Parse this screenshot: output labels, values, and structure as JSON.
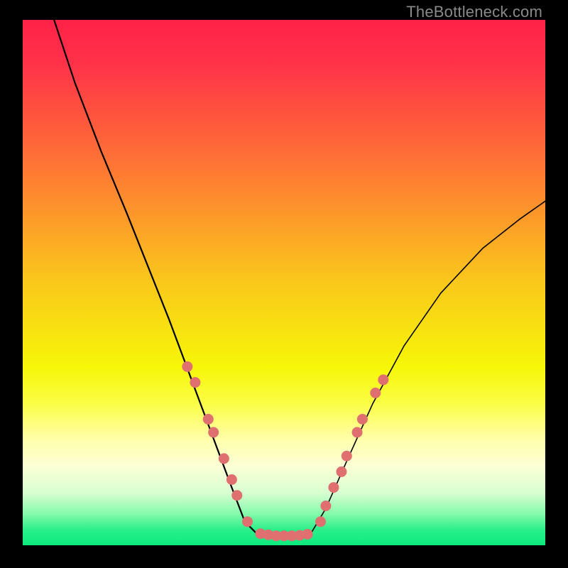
{
  "watermark": "TheBottleneck.com",
  "chart_data": {
    "type": "line",
    "title": "",
    "xlabel": "",
    "ylabel": "",
    "xlim": [
      0,
      100
    ],
    "ylim": [
      0,
      100
    ],
    "grid": false,
    "background_gradient_stops": [
      {
        "offset": 0.0,
        "color": "#FF2247"
      },
      {
        "offset": 0.08,
        "color": "#FF3149"
      },
      {
        "offset": 0.28,
        "color": "#FE7634"
      },
      {
        "offset": 0.5,
        "color": "#FAC81B"
      },
      {
        "offset": 0.66,
        "color": "#F6F607"
      },
      {
        "offset": 0.73,
        "color": "#FBFD45"
      },
      {
        "offset": 0.8,
        "color": "#FFFFAD"
      },
      {
        "offset": 0.85,
        "color": "#FBFFD5"
      },
      {
        "offset": 0.9,
        "color": "#D8FFD1"
      },
      {
        "offset": 0.94,
        "color": "#85FAAB"
      },
      {
        "offset": 0.97,
        "color": "#2BEF89"
      },
      {
        "offset": 1.0,
        "color": "#0CEA7D"
      }
    ],
    "series": [
      {
        "name": "left-branch",
        "color": "#000000",
        "stroke_width": 2.2,
        "x": [
          6.0,
          10.0,
          15.0,
          20.0,
          24.0,
          28.0,
          31.0,
          34.0,
          37.0,
          40.0,
          42.5,
          45.0
        ],
        "y": [
          100.0,
          88.0,
          75.0,
          63.0,
          53.0,
          43.0,
          35.0,
          27.0,
          19.0,
          11.0,
          4.5,
          2.0
        ]
      },
      {
        "name": "valley-floor",
        "color": "#000000",
        "stroke_width": 2.2,
        "x": [
          45.0,
          48.0,
          52.0,
          55.0
        ],
        "y": [
          2.0,
          1.5,
          1.5,
          2.0
        ]
      },
      {
        "name": "right-branch",
        "color": "#000000",
        "stroke_width": 1.6,
        "x": [
          55.0,
          58.0,
          62.0,
          67.0,
          73.0,
          80.0,
          88.0,
          95.0,
          100.0
        ],
        "y": [
          2.0,
          7.0,
          16.0,
          27.0,
          38.0,
          48.0,
          56.5,
          62.0,
          65.5
        ]
      }
    ],
    "scatter": {
      "name": "dots",
      "color": "#E07070",
      "radius": 7.5,
      "points": [
        {
          "x": 31.5,
          "y": 34.0
        },
        {
          "x": 33.0,
          "y": 31.0
        },
        {
          "x": 35.5,
          "y": 24.0
        },
        {
          "x": 36.5,
          "y": 21.5
        },
        {
          "x": 38.5,
          "y": 16.5
        },
        {
          "x": 40.0,
          "y": 12.5
        },
        {
          "x": 41.0,
          "y": 9.5
        },
        {
          "x": 43.0,
          "y": 4.5
        },
        {
          "x": 45.5,
          "y": 2.2
        },
        {
          "x": 47.0,
          "y": 2.0
        },
        {
          "x": 48.5,
          "y": 1.8
        },
        {
          "x": 50.0,
          "y": 1.8
        },
        {
          "x": 51.5,
          "y": 1.8
        },
        {
          "x": 53.0,
          "y": 1.9
        },
        {
          "x": 54.5,
          "y": 2.1
        },
        {
          "x": 57.0,
          "y": 4.5
        },
        {
          "x": 58.0,
          "y": 7.5
        },
        {
          "x": 59.5,
          "y": 11.0
        },
        {
          "x": 61.0,
          "y": 14.0
        },
        {
          "x": 62.0,
          "y": 17.0
        },
        {
          "x": 64.0,
          "y": 21.5
        },
        {
          "x": 65.0,
          "y": 24.0
        },
        {
          "x": 67.5,
          "y": 29.0
        },
        {
          "x": 69.0,
          "y": 31.5
        }
      ]
    }
  }
}
